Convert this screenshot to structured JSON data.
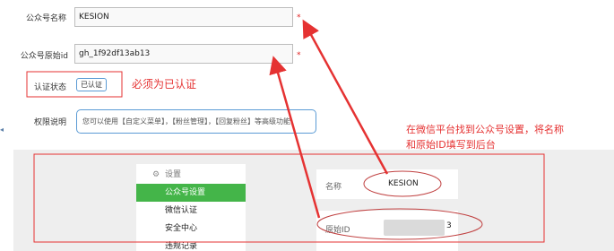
{
  "form": {
    "name_label": "公众号名称",
    "name_value": "KESION",
    "origin_label": "公众号原始id",
    "origin_value": "gh_1f92df13ab13",
    "required_mark": "*",
    "status_label": "认证状态",
    "status_value": "已认证",
    "status_note": "必须为已认证",
    "perm_label": "权限说明",
    "perm_text": "您可以使用【自定义菜单】，【粉丝管理】，【回复粉丝】等高级功能"
  },
  "annotation": {
    "line1": "在微信平台找到公众号设置，将名称",
    "line2": "和原始ID填写到后台"
  },
  "preview": {
    "menu_header": "设置",
    "menu_items": [
      "公众号设置",
      "微信认证",
      "安全中心",
      "违规记录"
    ],
    "name_label": "名称",
    "name_value": "KESION",
    "origin_label": "原始ID",
    "origin_suffix": "3"
  },
  "colors": {
    "accent_green": "#44b549",
    "annotation_red": "#e53232",
    "badge_blue": "#5b9bd5"
  }
}
